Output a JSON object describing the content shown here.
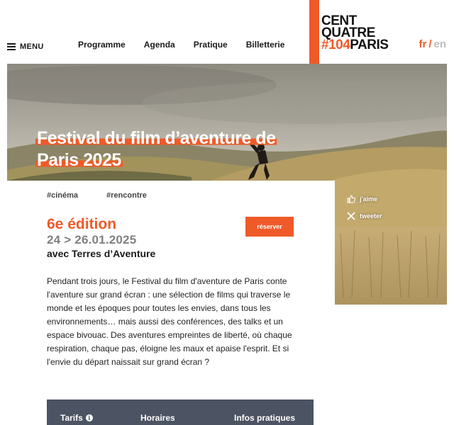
{
  "header": {
    "menu_label": "MENU",
    "nav": [
      "Programme",
      "Agenda",
      "Pratique",
      "Billetterie"
    ],
    "logo": {
      "line1": "CENT",
      "line2": "QUATRE",
      "line3_hash": "#104",
      "line3_city": "PARIS"
    },
    "lang": {
      "fr": "fr",
      "sep": "/",
      "en": "en"
    }
  },
  "hero": {
    "title": "Festival du film d’aventure de Paris 2025"
  },
  "event": {
    "tags": [
      "#cinéma",
      "#rencontre"
    ],
    "edition": "6e édition",
    "dates": "24 > 26.01.2025",
    "partner": "avec Terres d’Aventure",
    "reserve_label": "réserver",
    "description": "Pendant trois jours, le Festival du film d'aventure de Paris conte l'aventure sur grand écran : une sélection de films qui traverse le monde et les époques pour toutes les envies, dans tous les environnements… mais aussi des conférences, des talks et un espace bivouac. Des aventures empreintes de liberté, où chaque respiration, chaque pas, éloigne les maux et apaise l'esprit. Et si l'envie du départ naissait sur grand écran ?",
    "info_tabs": [
      "Tarifs",
      "Horaires",
      "Infos pratiques"
    ]
  },
  "social": {
    "like_label": "j'aime",
    "tweet_label": "tweeter"
  },
  "colors": {
    "accent": "#ef5a28",
    "info_bar": "#4c5362",
    "date_gray": "#808080"
  },
  "icons": [
    "menu-icon",
    "thumbs-up-icon",
    "x-logo-icon",
    "info-icon"
  ]
}
